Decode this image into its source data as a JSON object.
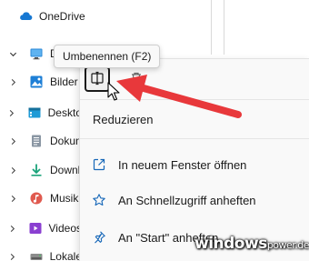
{
  "tree": {
    "items": [
      {
        "label": "OneDrive",
        "icon": "cloud-icon",
        "chevron": "none",
        "color": "#1677d2"
      },
      {
        "label": "Die",
        "icon": "computer-icon",
        "chevron": "down",
        "color": "#2b88d8"
      },
      {
        "label": "Bilder",
        "icon": "pictures-icon",
        "chevron": "right",
        "color": "#1e7fd6"
      },
      {
        "label": "Deskto",
        "icon": "desktop-icon",
        "chevron": "right",
        "color": "#1e9ad6"
      },
      {
        "label": "Dokun",
        "icon": "documents-icon",
        "chevron": "right",
        "color": "#7b8794"
      },
      {
        "label": "Downl",
        "icon": "download-icon",
        "chevron": "right",
        "color": "#1aa37a"
      },
      {
        "label": "Musik",
        "icon": "music-icon",
        "chevron": "right",
        "color": "#e05a4f"
      },
      {
        "label": "Videos",
        "icon": "videos-icon",
        "chevron": "right",
        "color": "#8a3fd1"
      },
      {
        "label": "Lokale",
        "icon": "drive-icon",
        "chevron": "right",
        "color": "#666666"
      }
    ]
  },
  "tooltip": {
    "text": "Umbenennen (F2)"
  },
  "context_menu": {
    "toolbar": [
      {
        "name": "rename",
        "icon": "rename-icon"
      },
      {
        "name": "delete",
        "icon": "trash-icon"
      }
    ],
    "items": [
      {
        "label": "Reduzieren",
        "icon": ""
      },
      {
        "label": "In neuem Fenster öffnen",
        "icon": "open-new-window-icon"
      },
      {
        "label": "An Schnellzugriff anheften",
        "icon": "star-icon"
      },
      {
        "label": "An \"Start\" anheften",
        "icon": "pin-icon"
      }
    ]
  },
  "watermark": {
    "main": "windows",
    "small": "power",
    "suffix": ".de"
  },
  "colors": {
    "accent": "#1677d2",
    "arrow": "#e8383b"
  }
}
